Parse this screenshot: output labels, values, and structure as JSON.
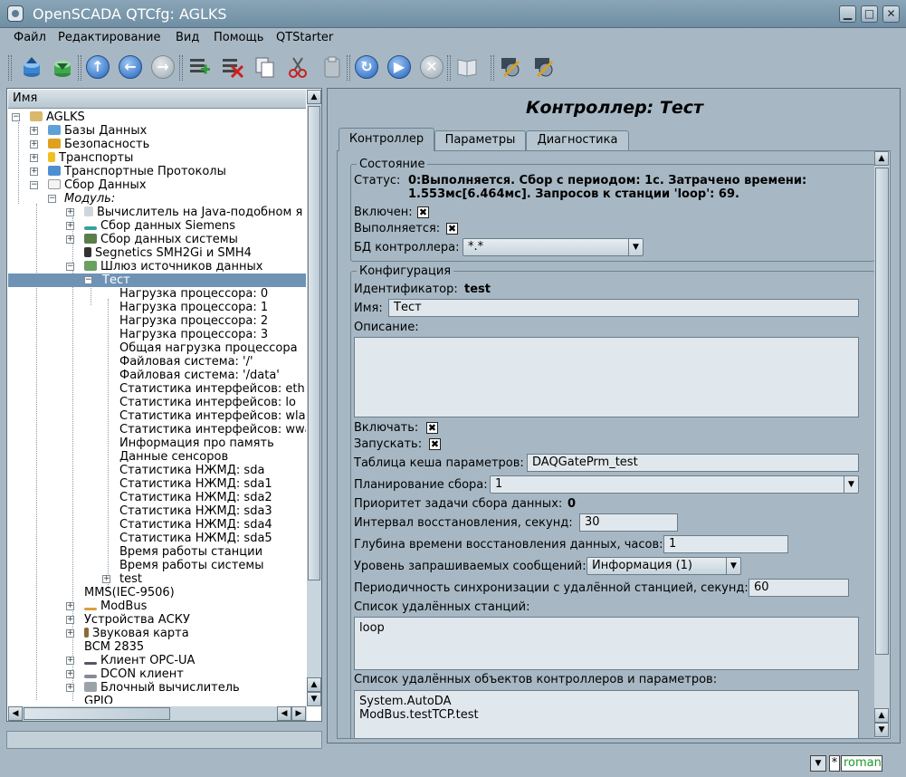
{
  "window": {
    "title": "OpenSCADA QTCfg: AGLKS"
  },
  "menu": [
    "Файл",
    "Редактирование",
    "Вид",
    "Помощь",
    "QTStarter"
  ],
  "tree": {
    "header": "Имя",
    "items": [
      "AGLKS",
      "Базы Данных",
      "Безопасность",
      "Транспорты",
      "Транспортные Протоколы",
      "Сбор Данных",
      "Модуль:",
      "Вычислитель на Java-подобном я",
      "Сбор данных Siemens",
      "Сбор данных системы",
      "Segnetics SMH2Gi и SMH4",
      "Шлюз источников данных",
      "Тест",
      "Нагрузка процессора: 0",
      "Нагрузка процессора: 1",
      "Нагрузка процессора: 2",
      "Нагрузка процессора: 3",
      "Общая нагрузка процессора",
      "Файловая система: '/'",
      "Файловая система: '/data'",
      "Статистика интерфейсов: eth",
      "Статистика интерфейсов: lo",
      "Статистика интерфейсов: wla",
      "Статистика интерфейсов: wwa",
      "Информация про память",
      "Данные сенсоров",
      "Статистика НЖМД: sda",
      "Статистика НЖМД: sda1",
      "Статистика НЖМД: sda2",
      "Статистика НЖМД: sda3",
      "Статистика НЖМД: sda4",
      "Статистика НЖМД: sda5",
      "Время работы станции",
      "Время работы системы",
      "test",
      "MMS(IEC-9506)",
      "ModBus",
      "Устройства АСКУ",
      "Звуковая карта",
      "BCM 2835",
      "Клиент OPC-UA",
      "DCON клиент",
      "Блочный вычислитель",
      "GPIO"
    ]
  },
  "page": {
    "title": "Контроллер: Тест",
    "tabs": [
      "Контроллер",
      "Параметры",
      "Диагностика"
    ],
    "state": {
      "legend": "Состояние",
      "status_label": "Статус:",
      "status_line1": "0:Выполняется. Сбор с периодом: 1с. Затрачено времени:",
      "status_line2": "1.553мс[6.464мс]. Запросов к станции 'loop': 69.",
      "enabled_label": "Включен:",
      "running_label": "Выполняется:",
      "db_label": "БД контроллера:",
      "db_value": "*.*"
    },
    "config": {
      "legend": "Конфигурация",
      "id_label": "Идентификатор:",
      "id_value": "test",
      "name_label": "Имя:",
      "name_value": "Тест",
      "descr_label": "Описание:",
      "descr_value": "",
      "to_enable_label": "Включать:",
      "to_start_label": "Запускать:",
      "cache_label": "Таблица кеша параметров:",
      "cache_value": "DAQGatePrm_test",
      "schedule_label": "Планирование сбора:",
      "schedule_value": "1",
      "priority_label": "Приоритет задачи сбора данных:",
      "priority_value": "0",
      "restore_label": "Интервал восстановления, секунд:",
      "restore_value": "30",
      "depth_label": "Глубина времени восстановления данных, часов:",
      "depth_value": "1",
      "msg_level_label": "Уровень запрашиваемых сообщений:",
      "msg_level_value": "Информация (1)",
      "sync_label": "Периодичность синхронизации с удалённой станцией, секунд:",
      "sync_value": "60",
      "stations_label": "Список удалённых станций:",
      "stations_value": "loop",
      "objects_label": "Список удалённых объектов контроллеров и параметров:",
      "objects_line1": "System.AutoDA",
      "objects_line2": "ModBus.testTCP.test"
    }
  },
  "statusbar": {
    "user": "roman",
    "star": "*"
  }
}
